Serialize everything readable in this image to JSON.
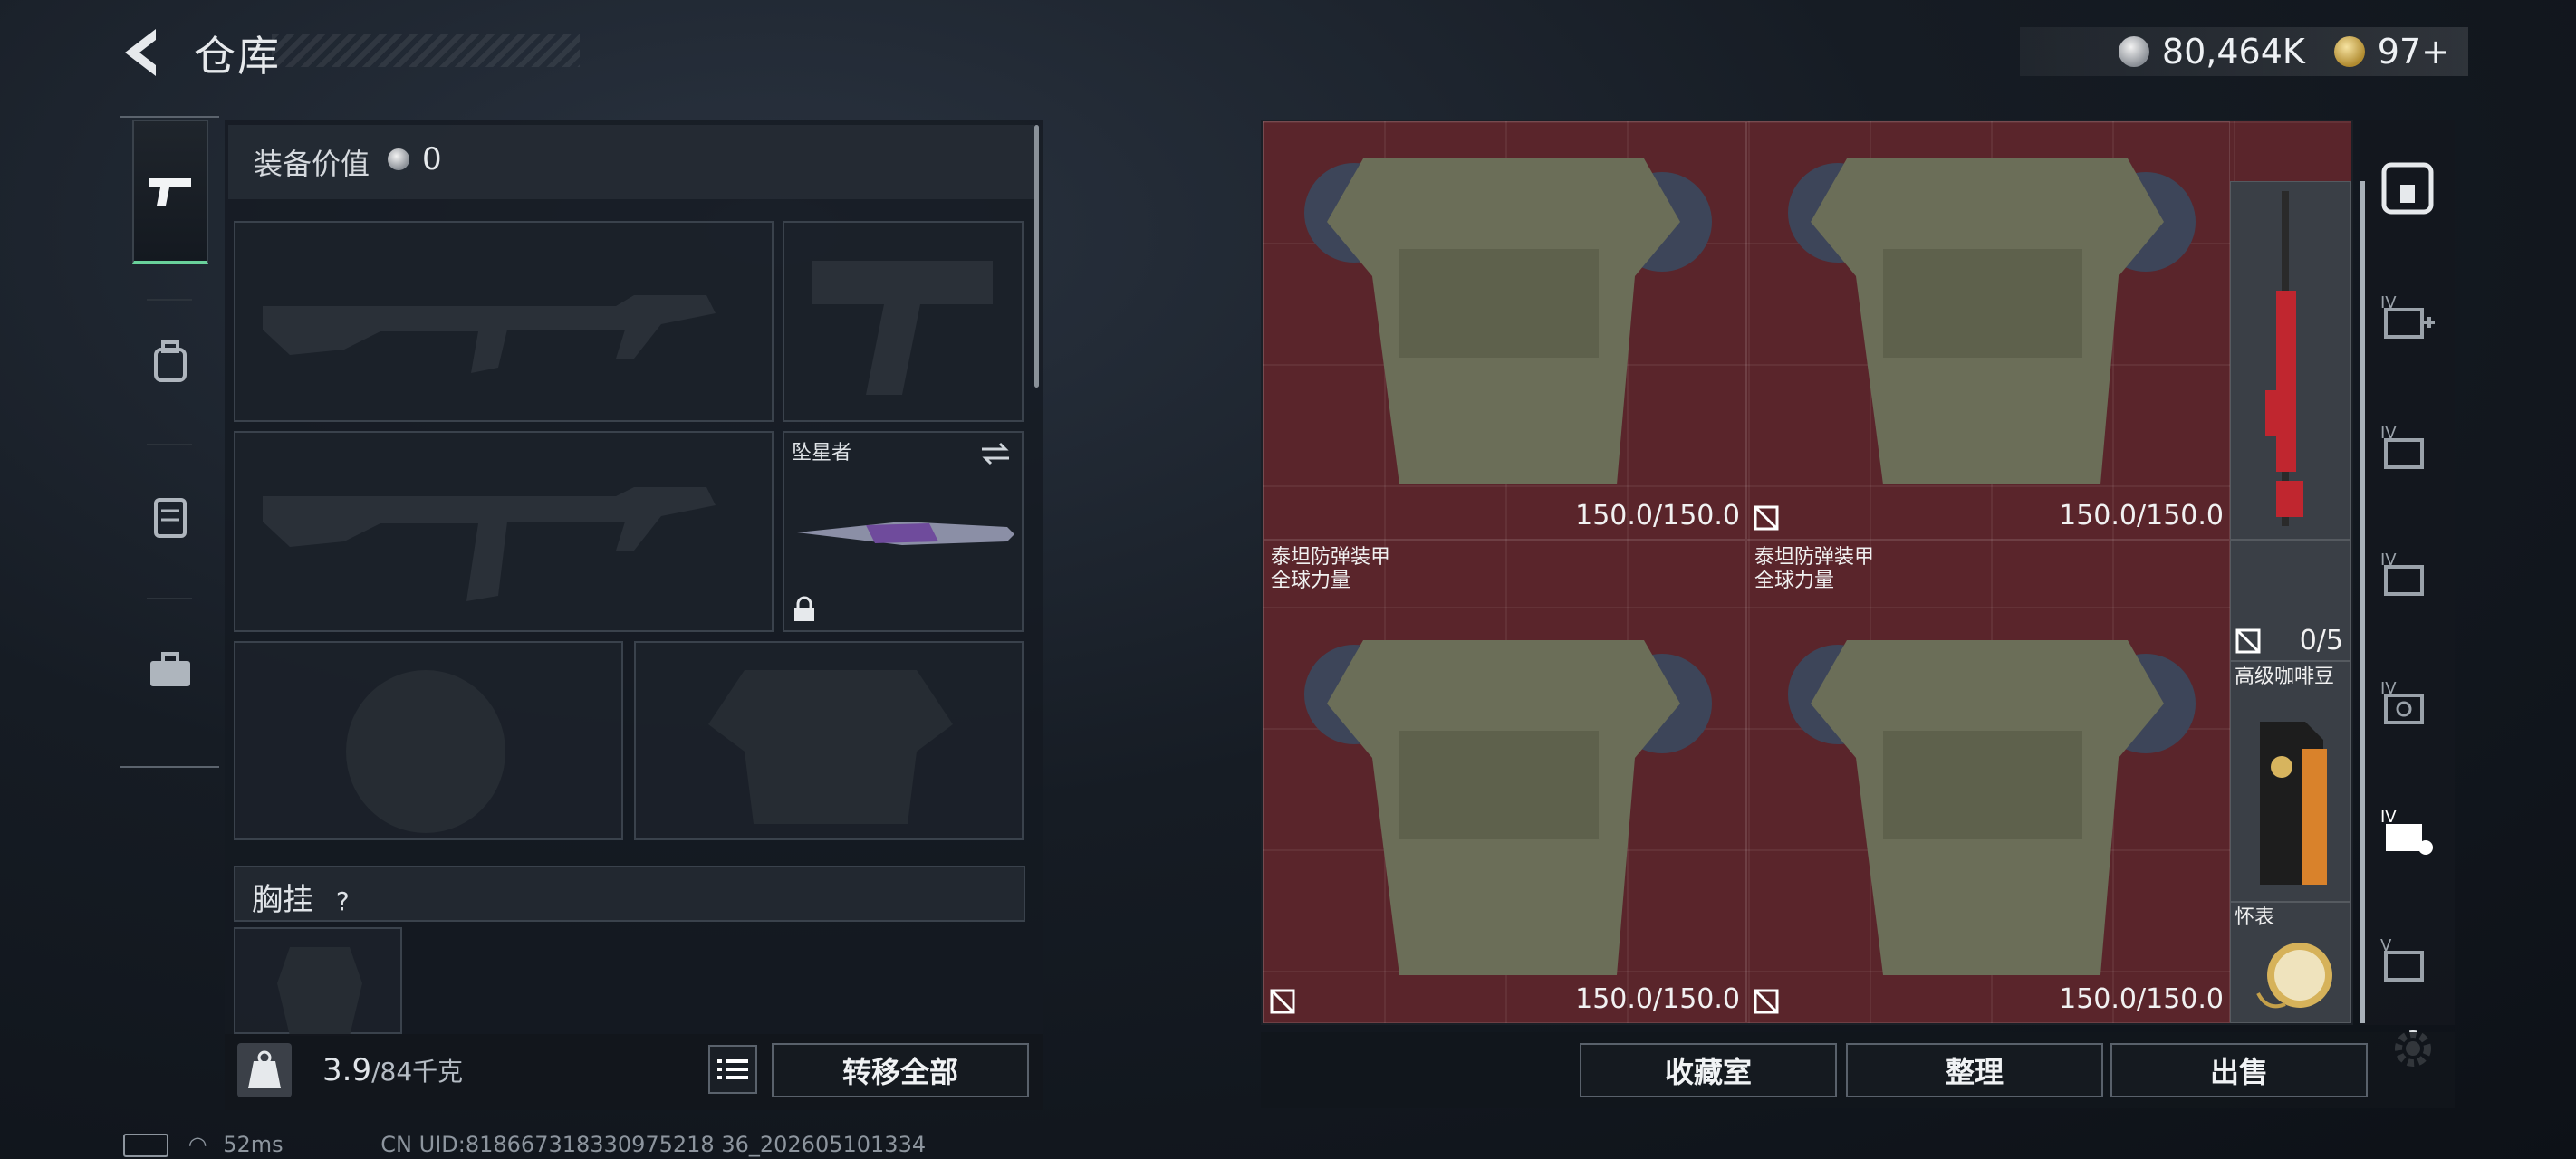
{
  "header": {
    "title": "仓库",
    "silver_amount": "80,464K",
    "gold_amount": "97+"
  },
  "equipment": {
    "value_label": "装备价值",
    "value": "0",
    "melee_name": "坠星者",
    "chest_label": "胸挂",
    "chest_help": "?",
    "weight_current": "3.9",
    "weight_max": "/84千克",
    "transfer_all": "转移全部"
  },
  "storage": {
    "items": [
      {
        "name": "",
        "durability": "150.0/150.0"
      },
      {
        "name": "",
        "durability": "150.0/150.0"
      },
      {
        "name": "泰坦防弹装甲\n全球力量",
        "durability": "150.0/150.0"
      },
      {
        "name": "泰坦防弹装甲\n全球力量",
        "durability": "150.0/150.0"
      }
    ],
    "rifle_count": "0/5",
    "coffee_name": "高级咖啡豆",
    "watch_name": "怀表",
    "buttons": {
      "collection": "收藏室",
      "sort": "整理",
      "sell": "出售"
    }
  },
  "statusbar": {
    "ping": "52ms",
    "uid": "CN UID:818667318330975218 36_202605101334"
  }
}
